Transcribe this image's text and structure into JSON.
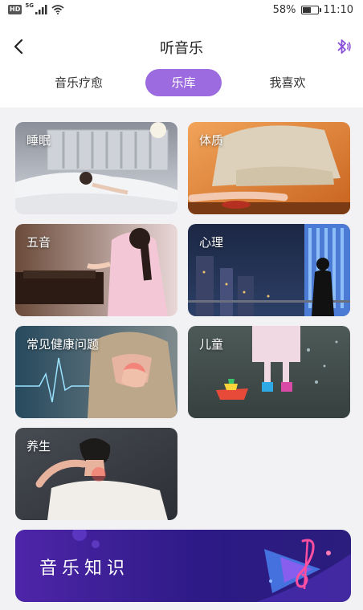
{
  "status_bar": {
    "hd": "HD",
    "network": "5G",
    "battery_percent": "58%",
    "battery_level": 0.58,
    "time": "11:10"
  },
  "header": {
    "title": "听音乐",
    "back_icon": "back-arrow-icon",
    "right_icon": "bluetooth-icon"
  },
  "tabs": [
    {
      "label": "音乐疗愈",
      "active": false
    },
    {
      "label": "乐库",
      "active": true
    },
    {
      "label": "我喜欢",
      "active": false
    }
  ],
  "categories": [
    {
      "label": "睡眠"
    },
    {
      "label": "体质"
    },
    {
      "label": "五音"
    },
    {
      "label": "心理"
    },
    {
      "label": "常见健康问题"
    },
    {
      "label": "儿童"
    },
    {
      "label": "养生"
    }
  ],
  "banner": {
    "title": "音乐知识",
    "icon": "music-note-icon"
  },
  "colors": {
    "accent": "#9b6bdf",
    "banner_start": "#4e25a8",
    "banner_end": "#2a1d7c",
    "page_bg": "#f2f2f4"
  }
}
